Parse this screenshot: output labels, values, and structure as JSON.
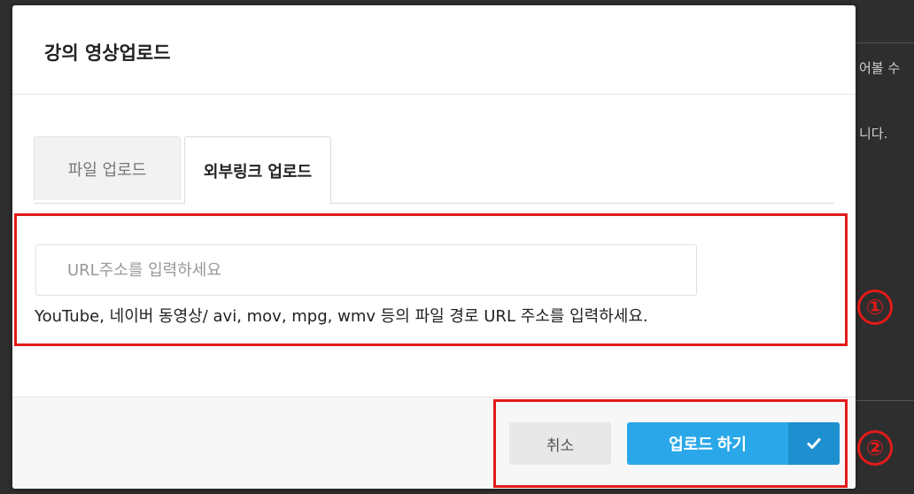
{
  "background": {
    "fragments": [
      "어볼 수",
      "니다."
    ]
  },
  "modal": {
    "title": "강의 영상업로드",
    "tabs": [
      {
        "label": "파일 업로드",
        "active": false
      },
      {
        "label": "외부링크 업로드",
        "active": true
      }
    ],
    "url_input": {
      "placeholder": "URL주소를 입력하세요",
      "value": ""
    },
    "help_text": "YouTube, 네이버 동영상/ avi, mov, mpg, wmv 등의 파일 경로 URL 주소를 입력하세요.",
    "footer": {
      "cancel_label": "취소",
      "upload_label": "업로드 하기"
    }
  },
  "annotations": {
    "marker_1": "①",
    "marker_2": "②"
  },
  "colors": {
    "primary": "#2aa7e8",
    "primary_dark": "#1e90d0",
    "annotation": "#e21a1a"
  },
  "icons": {
    "upload_button_icon": "check-icon"
  }
}
